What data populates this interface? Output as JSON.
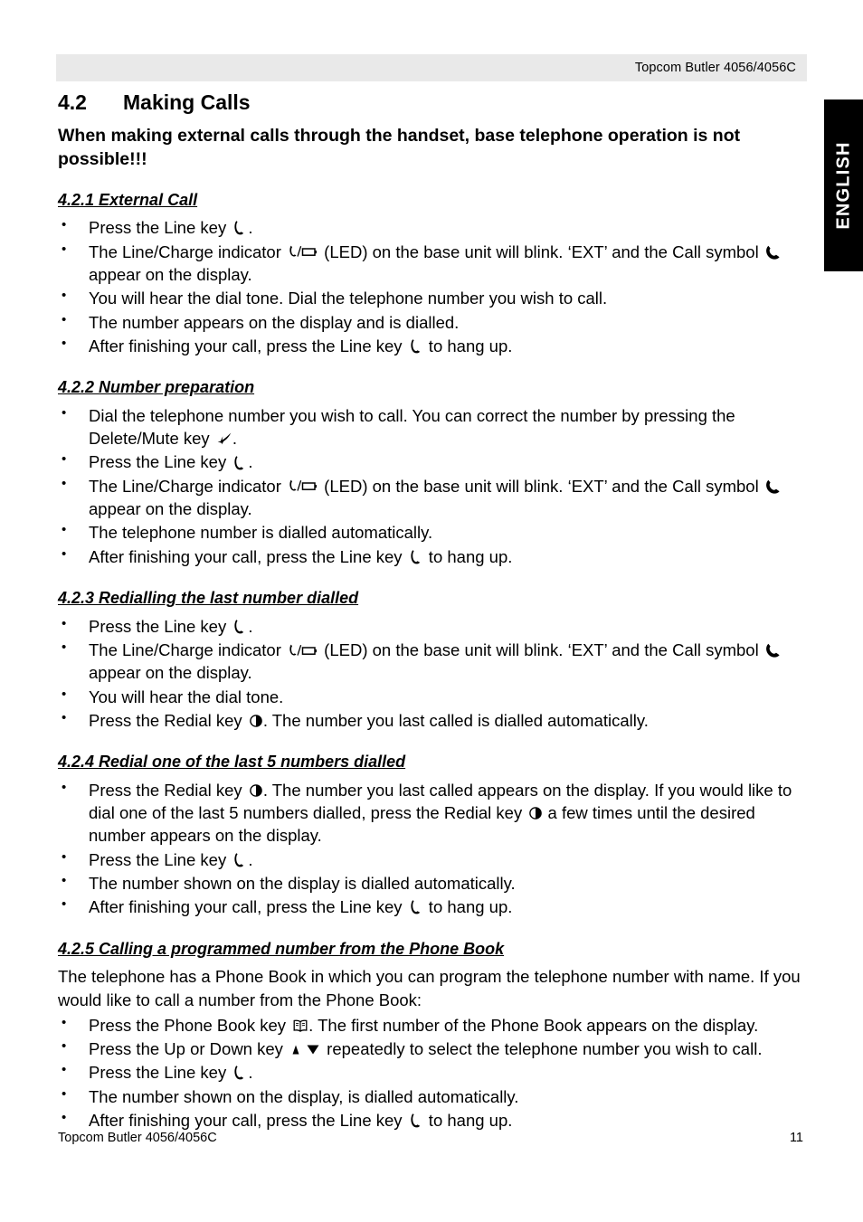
{
  "header": {
    "running_head": "Topcom Butler 4056/4056C"
  },
  "language_tab": {
    "label": "ENGLISH"
  },
  "section": {
    "number": "4.2",
    "title": "Making Calls",
    "lead": "When making external calls through the handset, base telephone operation is not possible!!!"
  },
  "icons": {
    "line_key": "line-key-handset-icon",
    "line_charge": "line-charge-indicator-icon",
    "call_symbol": "call-handset-icon",
    "delete_mute": "delete-mute-arrow-icon",
    "redial": "redial-half-circle-icon",
    "phone_book": "phone-book-open-book-icon",
    "up_down": "up-down-triangles-icon"
  },
  "subsections": [
    {
      "heading": "4.2.1 External Call",
      "bullets": [
        {
          "parts": [
            {
              "t": "text",
              "v": "Press the Line key "
            },
            {
              "t": "icon",
              "v": "line_key"
            },
            {
              "t": "text",
              "v": "."
            }
          ]
        },
        {
          "parts": [
            {
              "t": "text",
              "v": "The Line/Charge indicator "
            },
            {
              "t": "icon",
              "v": "line_charge"
            },
            {
              "t": "text",
              "v": " (LED) on the base unit will blink. ‘EXT’ and the Call symbol "
            },
            {
              "t": "icon",
              "v": "call_symbol"
            },
            {
              "t": "text",
              "v": " appear on the display."
            }
          ]
        },
        {
          "parts": [
            {
              "t": "text",
              "v": "You will hear the dial tone. Dial the telephone number you wish to call."
            }
          ]
        },
        {
          "parts": [
            {
              "t": "text",
              "v": "The number appears on the display and is dialled."
            }
          ]
        },
        {
          "parts": [
            {
              "t": "text",
              "v": "After finishing your call, press the Line key "
            },
            {
              "t": "icon",
              "v": "line_key"
            },
            {
              "t": "text",
              "v": " to hang up."
            }
          ]
        }
      ]
    },
    {
      "heading": "4.2.2 Number preparation",
      "bullets": [
        {
          "parts": [
            {
              "t": "text",
              "v": "Dial the telephone number you wish to call. You can correct the number by pressing the Delete/Mute key "
            },
            {
              "t": "icon",
              "v": "delete_mute"
            },
            {
              "t": "text",
              "v": "."
            }
          ]
        },
        {
          "parts": [
            {
              "t": "text",
              "v": "Press the Line key "
            },
            {
              "t": "icon",
              "v": "line_key"
            },
            {
              "t": "text",
              "v": "."
            }
          ]
        },
        {
          "parts": [
            {
              "t": "text",
              "v": "The Line/Charge indicator "
            },
            {
              "t": "icon",
              "v": "line_charge"
            },
            {
              "t": "text",
              "v": " (LED) on the base unit will blink. ‘EXT’ and the Call symbol "
            },
            {
              "t": "icon",
              "v": "call_symbol"
            },
            {
              "t": "text",
              "v": " appear on the display."
            }
          ]
        },
        {
          "parts": [
            {
              "t": "text",
              "v": "The telephone number is dialled automatically."
            }
          ]
        },
        {
          "parts": [
            {
              "t": "text",
              "v": "After finishing your call, press the Line key "
            },
            {
              "t": "icon",
              "v": "line_key"
            },
            {
              "t": "text",
              "v": " to hang up."
            }
          ]
        }
      ]
    },
    {
      "heading": "4.2.3 Redialling the last number dialled",
      "bullets": [
        {
          "parts": [
            {
              "t": "text",
              "v": "Press the Line key "
            },
            {
              "t": "icon",
              "v": "line_key"
            },
            {
              "t": "text",
              "v": "."
            }
          ]
        },
        {
          "parts": [
            {
              "t": "text",
              "v": "The Line/Charge indicator "
            },
            {
              "t": "icon",
              "v": "line_charge"
            },
            {
              "t": "text",
              "v": " (LED) on the base unit will blink. ‘EXT’ and the Call symbol "
            },
            {
              "t": "icon",
              "v": "call_symbol"
            },
            {
              "t": "text",
              "v": " appear on the display."
            }
          ]
        },
        {
          "parts": [
            {
              "t": "text",
              "v": "You will hear the dial tone."
            }
          ]
        },
        {
          "parts": [
            {
              "t": "text",
              "v": "Press the Redial key "
            },
            {
              "t": "icon",
              "v": "redial"
            },
            {
              "t": "text",
              "v": ". The number you last called is dialled automatically."
            }
          ]
        }
      ]
    },
    {
      "heading": "4.2.4 Redial one of the last 5 numbers dialled",
      "bullets": [
        {
          "parts": [
            {
              "t": "text",
              "v": "Press the Redial key "
            },
            {
              "t": "icon",
              "v": "redial"
            },
            {
              "t": "text",
              "v": ". The number you last called appears on the display. If you would like to dial one of the last 5 numbers dialled, press the Redial key "
            },
            {
              "t": "icon",
              "v": "redial"
            },
            {
              "t": "text",
              "v": " a few times until the desired number appears on the display."
            }
          ]
        },
        {
          "parts": [
            {
              "t": "text",
              "v": "Press the Line key "
            },
            {
              "t": "icon",
              "v": "line_key"
            },
            {
              "t": "text",
              "v": "."
            }
          ]
        },
        {
          "parts": [
            {
              "t": "text",
              "v": "The number shown on the display is dialled automatically."
            }
          ]
        },
        {
          "parts": [
            {
              "t": "text",
              "v": "After finishing your call, press the Line key "
            },
            {
              "t": "icon",
              "v": "line_key"
            },
            {
              "t": "text",
              "v": " to hang up."
            }
          ]
        }
      ]
    },
    {
      "heading": "4.2.5 Calling a programmed number from the Phone Book",
      "intro": "The telephone has a Phone Book in which you can program the telephone number with name. If you would like to call a number from the Phone Book:",
      "bullets": [
        {
          "parts": [
            {
              "t": "text",
              "v": "Press the Phone Book key "
            },
            {
              "t": "icon",
              "v": "phone_book"
            },
            {
              "t": "text",
              "v": ". The first number of the Phone Book appears on the display."
            }
          ]
        },
        {
          "parts": [
            {
              "t": "text",
              "v": "Press the Up or Down key "
            },
            {
              "t": "icon",
              "v": "up_down"
            },
            {
              "t": "text",
              "v": " repeatedly to select the telephone number you wish to call."
            }
          ]
        },
        {
          "parts": [
            {
              "t": "text",
              "v": "Press the Line key "
            },
            {
              "t": "icon",
              "v": "line_key"
            },
            {
              "t": "text",
              "v": "."
            }
          ]
        },
        {
          "parts": [
            {
              "t": "text",
              "v": "The number shown on the display, is dialled automatically."
            }
          ]
        },
        {
          "parts": [
            {
              "t": "text",
              "v": "After finishing your call, press the Line key "
            },
            {
              "t": "icon",
              "v": "line_key"
            },
            {
              "t": "text",
              "v": " to hang up."
            }
          ]
        }
      ]
    }
  ],
  "footer": {
    "left": "Topcom Butler 4056/4056C",
    "page_number": "11"
  }
}
